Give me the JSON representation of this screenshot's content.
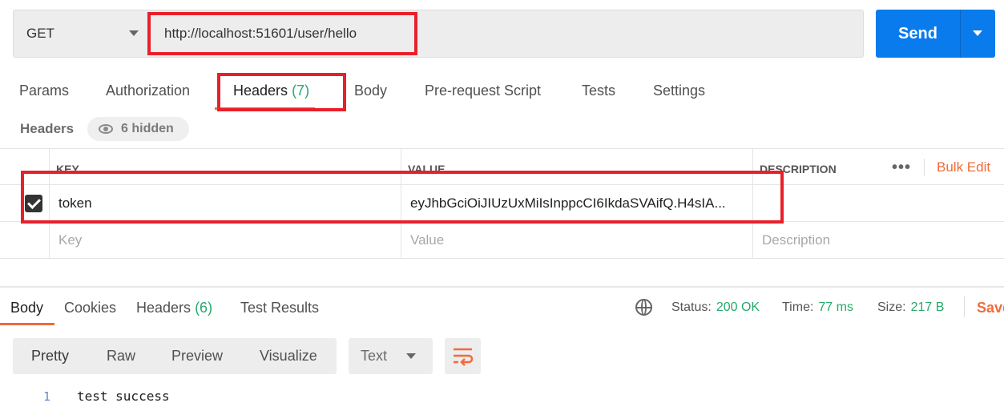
{
  "request": {
    "method": "GET",
    "url": "http://localhost:51601/user/hello",
    "send_label": "Send"
  },
  "tabs": [
    {
      "label": "Params"
    },
    {
      "label": "Authorization"
    },
    {
      "label": "Headers",
      "count": "(7)"
    },
    {
      "label": "Body"
    },
    {
      "label": "Pre-request Script"
    },
    {
      "label": "Tests"
    },
    {
      "label": "Settings"
    }
  ],
  "headers_panel": {
    "title": "Headers",
    "hidden_label": "6 hidden",
    "columns": {
      "key": "KEY",
      "value": "VALUE",
      "description": "DESCRIPTION"
    },
    "more_label": "•••",
    "bulk_edit": "Bulk Edit",
    "rows": [
      {
        "key": "token",
        "value": "eyJhbGciOiJIUzUxMiIsInppcCI6IkdaSVAifQ.H4sIA...",
        "checked": true
      }
    ],
    "placeholders": {
      "key": "Key",
      "value": "Value",
      "description": "Description"
    }
  },
  "response": {
    "tabs": [
      {
        "label": "Body"
      },
      {
        "label": "Cookies"
      },
      {
        "label": "Headers",
        "count": "(6)"
      },
      {
        "label": "Test Results"
      }
    ],
    "status_label": "Status:",
    "status_value": "200 OK",
    "time_label": "Time:",
    "time_value": "77 ms",
    "size_label": "Size:",
    "size_value": "217 B",
    "save_label": "Save",
    "formats": [
      "Pretty",
      "Raw",
      "Preview",
      "Visualize"
    ],
    "language": "Text",
    "code": {
      "line_number": "1",
      "text": "test success"
    }
  },
  "colors": {
    "accent": "#f26b3a",
    "send": "#097bed",
    "success": "#26a96c",
    "annotation": "#e8202a"
  }
}
